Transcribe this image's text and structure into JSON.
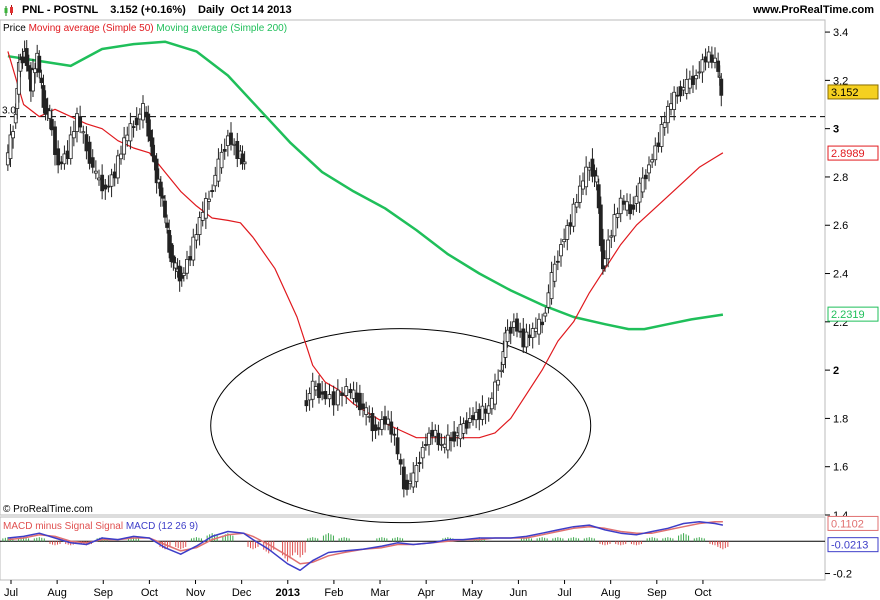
{
  "header": {
    "symbol": "PNL - POSTNL",
    "price_change": "3.152 (+0.16%)",
    "period_date": "Daily  Oct 14 2013",
    "site": "www.ProRealTime.com"
  },
  "legend": {
    "price_label": "Price",
    "ma50_label": "Moving average (Simple 50)",
    "ma200_label": "Moving average (Simple 200)"
  },
  "watermark": "© ProRealTime.com",
  "macd_legend": {
    "diff_label": "MACD minus Signal Signal",
    "macd_label": "MACD (12 26 9)"
  },
  "colors": {
    "price": "#1a1a1a",
    "ma50": "#e0191e",
    "ma200": "#1fbf5a",
    "macd_line": "#3d3dc8",
    "signal_line": "#e07070",
    "hist_pos": "#3aa84a",
    "hist_neg": "#e05050",
    "last_tag_bg": "#f5d020"
  },
  "chart_data": [
    {
      "type": "candlestick",
      "panel": "price",
      "y_ticks": [
        1.4,
        1.6,
        1.8,
        2,
        2.2,
        2.4,
        2.6,
        2.8,
        3,
        3.2,
        3.4
      ],
      "ylim": [
        1.4,
        3.45
      ],
      "x_ticks": [
        "Jul",
        "Aug",
        "Sep",
        "Oct",
        "Nov",
        "Dec",
        "2013",
        "Feb",
        "Mar",
        "Apr",
        "May",
        "Jun",
        "Jul",
        "Aug",
        "Sep",
        "Oct"
      ],
      "reference_line": {
        "value": 3.05,
        "label": "3.0",
        "style": "dashed"
      },
      "last_values": {
        "price": "3.152",
        "ma50": "2.8989",
        "ma200": "2.2319"
      },
      "price_close": [
        [
          0.0,
          2.85
        ],
        [
          0.05,
          3.0
        ],
        [
          0.08,
          3.25
        ],
        [
          0.12,
          3.32
        ],
        [
          0.16,
          3.18
        ],
        [
          0.2,
          3.3
        ],
        [
          0.24,
          3.1
        ],
        [
          0.28,
          3.05
        ],
        [
          0.34,
          2.85
        ],
        [
          0.4,
          2.9
        ],
        [
          0.46,
          3.05
        ],
        [
          0.52,
          2.92
        ],
        [
          0.58,
          2.8
        ],
        [
          0.64,
          2.75
        ],
        [
          0.7,
          2.82
        ],
        [
          0.76,
          2.95
        ],
        [
          0.82,
          3.02
        ],
        [
          0.88,
          3.08
        ],
        [
          0.92,
          2.95
        ],
        [
          0.96,
          2.8
        ],
        [
          1.0,
          2.7
        ],
        [
          1.04,
          2.5
        ],
        [
          1.08,
          2.42
        ],
        [
          1.12,
          2.38
        ],
        [
          1.18,
          2.48
        ],
        [
          1.24,
          2.62
        ],
        [
          1.3,
          2.72
        ],
        [
          1.36,
          2.85
        ],
        [
          1.42,
          2.97
        ],
        [
          1.48,
          2.9
        ],
        [
          1.52,
          2.85
        ],
        [
          1.9,
          1.85
        ],
        [
          1.96,
          1.93
        ],
        [
          2.02,
          1.9
        ],
        [
          2.1,
          1.88
        ],
        [
          2.18,
          1.92
        ],
        [
          2.24,
          1.88
        ],
        [
          2.3,
          1.82
        ],
        [
          2.36,
          1.75
        ],
        [
          2.42,
          1.8
        ],
        [
          2.48,
          1.72
        ],
        [
          2.54,
          1.52
        ],
        [
          2.6,
          1.55
        ],
        [
          2.66,
          1.68
        ],
        [
          2.72,
          1.75
        ],
        [
          2.78,
          1.68
        ],
        [
          2.84,
          1.72
        ],
        [
          2.9,
          1.75
        ],
        [
          2.96,
          1.8
        ],
        [
          3.02,
          1.82
        ],
        [
          3.08,
          1.84
        ],
        [
          3.14,
          1.97
        ],
        [
          3.18,
          2.13
        ],
        [
          3.24,
          2.2
        ],
        [
          3.3,
          2.12
        ],
        [
          3.36,
          2.16
        ],
        [
          3.42,
          2.2
        ],
        [
          3.48,
          2.38
        ],
        [
          3.54,
          2.52
        ],
        [
          3.6,
          2.62
        ],
        [
          3.66,
          2.75
        ],
        [
          3.72,
          2.85
        ],
        [
          3.76,
          2.78
        ],
        [
          3.8,
          2.42
        ],
        [
          3.86,
          2.58
        ],
        [
          3.92,
          2.7
        ],
        [
          3.98,
          2.66
        ],
        [
          4.04,
          2.75
        ],
        [
          4.1,
          2.85
        ],
        [
          4.16,
          2.95
        ],
        [
          4.22,
          3.08
        ],
        [
          4.28,
          3.15
        ],
        [
          4.34,
          3.18
        ],
        [
          4.4,
          3.22
        ],
        [
          4.46,
          3.3
        ],
        [
          4.52,
          3.28
        ],
        [
          4.55,
          3.15
        ]
      ],
      "ma50": [
        [
          0.0,
          3.32
        ],
        [
          0.1,
          3.1
        ],
        [
          0.2,
          3.05
        ],
        [
          0.3,
          3.08
        ],
        [
          0.4,
          3.05
        ],
        [
          0.5,
          3.02
        ],
        [
          0.6,
          3.0
        ],
        [
          0.7,
          2.95
        ],
        [
          0.8,
          2.92
        ],
        [
          0.9,
          2.9
        ],
        [
          1.0,
          2.82
        ],
        [
          1.1,
          2.74
        ],
        [
          1.2,
          2.68
        ],
        [
          1.3,
          2.63
        ],
        [
          1.4,
          2.62
        ],
        [
          1.48,
          2.61
        ],
        [
          1.56,
          2.55
        ],
        [
          1.7,
          2.42
        ],
        [
          1.84,
          2.22
        ],
        [
          1.94,
          2.02
        ],
        [
          2.02,
          1.95
        ],
        [
          2.1,
          1.92
        ],
        [
          2.2,
          1.86
        ],
        [
          2.3,
          1.82
        ],
        [
          2.4,
          1.78
        ],
        [
          2.5,
          1.75
        ],
        [
          2.6,
          1.72
        ],
        [
          2.7,
          1.72
        ],
        [
          2.8,
          1.72
        ],
        [
          2.9,
          1.72
        ],
        [
          3.0,
          1.72
        ],
        [
          3.1,
          1.74
        ],
        [
          3.2,
          1.8
        ],
        [
          3.3,
          1.9
        ],
        [
          3.4,
          2.0
        ],
        [
          3.5,
          2.12
        ],
        [
          3.6,
          2.2
        ],
        [
          3.7,
          2.32
        ],
        [
          3.8,
          2.42
        ],
        [
          3.9,
          2.52
        ],
        [
          4.0,
          2.6
        ],
        [
          4.1,
          2.66
        ],
        [
          4.2,
          2.72
        ],
        [
          4.3,
          2.78
        ],
        [
          4.4,
          2.84
        ],
        [
          4.5,
          2.88
        ],
        [
          4.55,
          2.9
        ]
      ],
      "ma200": [
        [
          0.0,
          3.3
        ],
        [
          0.2,
          3.28
        ],
        [
          0.4,
          3.26
        ],
        [
          0.6,
          3.33
        ],
        [
          0.8,
          3.35
        ],
        [
          1.0,
          3.36
        ],
        [
          1.2,
          3.32
        ],
        [
          1.4,
          3.22
        ],
        [
          1.6,
          3.08
        ],
        [
          1.8,
          2.94
        ],
        [
          2.0,
          2.82
        ],
        [
          2.2,
          2.74
        ],
        [
          2.4,
          2.67
        ],
        [
          2.6,
          2.58
        ],
        [
          2.8,
          2.48
        ],
        [
          3.0,
          2.4
        ],
        [
          3.2,
          2.33
        ],
        [
          3.4,
          2.27
        ],
        [
          3.6,
          2.22
        ],
        [
          3.8,
          2.19
        ],
        [
          3.95,
          2.17
        ],
        [
          4.05,
          2.17
        ],
        [
          4.2,
          2.19
        ],
        [
          4.35,
          2.21
        ],
        [
          4.55,
          2.23
        ]
      ]
    },
    {
      "type": "macd",
      "panel": "indicator",
      "y_ticks": [
        -0.2
      ],
      "ylim": [
        -0.24,
        0.15
      ],
      "last_values": {
        "macd": "0.1102",
        "diff": "-0.0213"
      },
      "macd": [
        [
          0.0,
          0.02
        ],
        [
          0.1,
          0.03
        ],
        [
          0.2,
          0.05
        ],
        [
          0.3,
          0.02
        ],
        [
          0.4,
          -0.01
        ],
        [
          0.5,
          -0.02
        ],
        [
          0.6,
          0.02
        ],
        [
          0.7,
          0.01
        ],
        [
          0.8,
          0.03
        ],
        [
          0.9,
          0.02
        ],
        [
          1.0,
          -0.04
        ],
        [
          1.1,
          -0.08
        ],
        [
          1.2,
          -0.03
        ],
        [
          1.3,
          0.03
        ],
        [
          1.4,
          0.06
        ],
        [
          1.5,
          0.05
        ],
        [
          1.56,
          0.01
        ],
        [
          1.66,
          -0.05
        ],
        [
          1.78,
          -0.14
        ],
        [
          1.86,
          -0.18
        ],
        [
          1.94,
          -0.12
        ],
        [
          2.04,
          -0.07
        ],
        [
          2.14,
          -0.06
        ],
        [
          2.26,
          -0.05
        ],
        [
          2.38,
          -0.03
        ],
        [
          2.48,
          -0.01
        ],
        [
          2.58,
          -0.02
        ],
        [
          2.7,
          -0.01
        ],
        [
          2.8,
          0.01
        ],
        [
          2.9,
          0.01
        ],
        [
          3.0,
          0.02
        ],
        [
          3.1,
          0.02
        ],
        [
          3.2,
          0.02
        ],
        [
          3.3,
          0.03
        ],
        [
          3.4,
          0.05
        ],
        [
          3.5,
          0.07
        ],
        [
          3.6,
          0.09
        ],
        [
          3.7,
          0.1
        ],
        [
          3.8,
          0.07
        ],
        [
          3.9,
          0.05
        ],
        [
          4.0,
          0.04
        ],
        [
          4.1,
          0.06
        ],
        [
          4.2,
          0.08
        ],
        [
          4.3,
          0.11
        ],
        [
          4.4,
          0.12
        ],
        [
          4.5,
          0.11
        ],
        [
          4.55,
          0.1
        ]
      ],
      "signal": [
        [
          0.0,
          0.01
        ],
        [
          0.1,
          0.02
        ],
        [
          0.2,
          0.04
        ],
        [
          0.3,
          0.03
        ],
        [
          0.4,
          0.0
        ],
        [
          0.5,
          -0.01
        ],
        [
          0.6,
          0.01
        ],
        [
          0.7,
          0.01
        ],
        [
          0.8,
          0.02
        ],
        [
          0.9,
          0.02
        ],
        [
          1.0,
          -0.02
        ],
        [
          1.1,
          -0.06
        ],
        [
          1.2,
          -0.04
        ],
        [
          1.3,
          0.01
        ],
        [
          1.4,
          0.04
        ],
        [
          1.5,
          0.05
        ],
        [
          1.56,
          0.03
        ],
        [
          1.66,
          -0.02
        ],
        [
          1.78,
          -0.09
        ],
        [
          1.86,
          -0.14
        ],
        [
          1.94,
          -0.13
        ],
        [
          2.04,
          -0.09
        ],
        [
          2.14,
          -0.07
        ],
        [
          2.26,
          -0.05
        ],
        [
          2.38,
          -0.04
        ],
        [
          2.48,
          -0.02
        ],
        [
          2.58,
          -0.02
        ],
        [
          2.7,
          -0.01
        ],
        [
          2.8,
          0.0
        ],
        [
          2.9,
          0.01
        ],
        [
          3.0,
          0.01
        ],
        [
          3.1,
          0.02
        ],
        [
          3.2,
          0.02
        ],
        [
          3.3,
          0.02
        ],
        [
          3.4,
          0.04
        ],
        [
          3.5,
          0.06
        ],
        [
          3.6,
          0.08
        ],
        [
          3.7,
          0.09
        ],
        [
          3.8,
          0.08
        ],
        [
          3.9,
          0.06
        ],
        [
          4.0,
          0.05
        ],
        [
          4.1,
          0.05
        ],
        [
          4.2,
          0.07
        ],
        [
          4.3,
          0.09
        ],
        [
          4.4,
          0.11
        ],
        [
          4.5,
          0.12
        ],
        [
          4.55,
          0.12
        ]
      ]
    }
  ]
}
